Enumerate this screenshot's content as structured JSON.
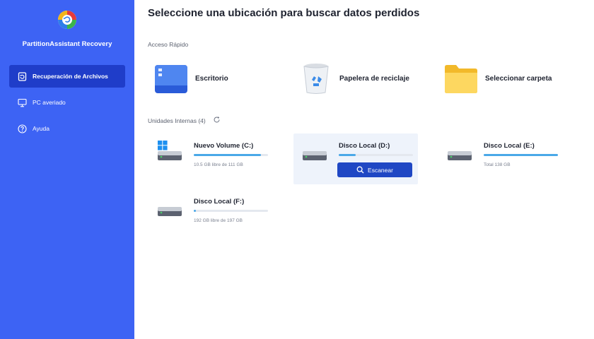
{
  "app": {
    "name": "PartitionAssistant Recovery"
  },
  "sidebar": {
    "items": [
      {
        "label": "Recuperación de Archivos",
        "active": true,
        "icon": "file-recovery-icon"
      },
      {
        "label": "PC averiado",
        "active": false,
        "icon": "monitor-icon"
      },
      {
        "label": "Ayuda",
        "active": false,
        "icon": "help-icon"
      }
    ]
  },
  "main": {
    "title": "Seleccione una ubicación para buscar datos perdidos",
    "quick_access": {
      "label": "Acceso Rápido",
      "items": [
        {
          "label": "Escritorio",
          "icon": "desktop-icon"
        },
        {
          "label": "Papelera de reciclaje",
          "icon": "recycle-bin-icon"
        },
        {
          "label": "Seleccionar carpeta",
          "icon": "folder-icon"
        }
      ]
    },
    "internal_drives": {
      "label": "Unidades Internas (4)",
      "drives": [
        {
          "name": "Nuevo Volume (C:)",
          "info": "10.5 GB libre de 111 GB",
          "used_fraction": 0.905,
          "system": true
        },
        {
          "name": "Disco Local (D:)",
          "info": "",
          "used_fraction": 0.23,
          "hovered": true,
          "scan_label": "Escanear"
        },
        {
          "name": "Disco Local (E:)",
          "info": "Total 138 GB",
          "used_fraction": 1.0
        },
        {
          "name": "Disco Local (F:)",
          "info": "192 GB libre de 197 GB",
          "used_fraction": 0.025
        }
      ]
    }
  },
  "colors": {
    "sidebar_bg": "#3d63f4",
    "sidebar_active": "#1f3dc9",
    "accent": "#1f47c4",
    "progress": "#4aa8e8"
  }
}
